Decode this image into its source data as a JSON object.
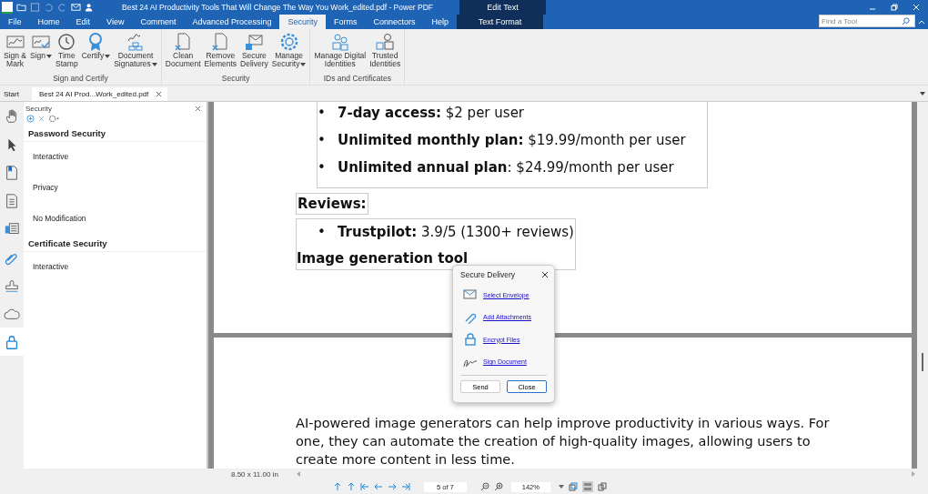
{
  "title_bar": {
    "title": "Best 24 AI Productivity Tools That Will Change The Way You Work_edited.pdf - Power PDF",
    "context_tab": "Edit Text"
  },
  "menu_tabs": [
    {
      "label": "File",
      "selected": false
    },
    {
      "label": "Home",
      "selected": false
    },
    {
      "label": "Edit",
      "selected": false
    },
    {
      "label": "View",
      "selected": false
    },
    {
      "label": "Comment",
      "selected": false
    },
    {
      "label": "Advanced Processing",
      "selected": false
    },
    {
      "label": "Security",
      "selected": true
    },
    {
      "label": "Forms",
      "selected": false
    },
    {
      "label": "Connectors",
      "selected": false
    },
    {
      "label": "Help",
      "selected": false
    }
  ],
  "context_menu_tab": "Text Format",
  "find_tool": {
    "placeholder": "Find a Tool"
  },
  "ribbon_groups": [
    {
      "label": "Sign and Certify",
      "buttons": [
        {
          "label": "Sign &\nMark",
          "dropdown": false
        },
        {
          "label": "Sign",
          "dropdown": true
        },
        {
          "label": "Time\nStamp",
          "dropdown": false
        },
        {
          "label": "Certify",
          "dropdown": true
        },
        {
          "label": "Document\nSignatures",
          "dropdown": true
        }
      ]
    },
    {
      "label": "Security",
      "buttons": [
        {
          "label": "Clean\nDocument",
          "dropdown": false
        },
        {
          "label": "Remove\nElements",
          "dropdown": false
        },
        {
          "label": "Secure\nDelivery",
          "dropdown": false
        },
        {
          "label": "Manage\nSecurity",
          "dropdown": true
        }
      ]
    },
    {
      "label": "IDs and Certificates",
      "buttons": [
        {
          "label": "Manage Digital\nIdentities",
          "dropdown": false
        },
        {
          "label": "Trusted\nIdentities",
          "dropdown": false
        }
      ]
    }
  ],
  "doc_tabs": [
    {
      "label": "Start",
      "selected": false,
      "closable": false
    },
    {
      "label": "Best 24 AI Prod...Work_edited.pdf",
      "selected": true,
      "closable": true
    }
  ],
  "side_tools": [
    {
      "selected": false
    },
    {
      "selected": false
    },
    {
      "selected": false
    },
    {
      "selected": false
    },
    {
      "selected": false
    },
    {
      "selected": false
    },
    {
      "selected": false
    },
    {
      "selected": false
    },
    {
      "selected": true
    }
  ],
  "panel": {
    "title": "Security",
    "sections": [
      {
        "heading": "Password Security",
        "items": [
          "Interactive",
          "Privacy",
          "No Modification"
        ]
      },
      {
        "heading": "Certificate Security",
        "items": [
          "Interactive"
        ]
      }
    ]
  },
  "page_one": {
    "plans": [
      {
        "bullet": "•",
        "text": "**7-day access:** $2 per user"
      },
      {
        "bullet": "•",
        "text": "**Unlimited monthly plan:** $19.99/month per user"
      },
      {
        "bullet": "•",
        "text": "**Unlimited annual plan**: $24.99/month per user"
      }
    ],
    "reviews_heading": "Reviews:",
    "reviews": [
      {
        "bullet": "•",
        "text": "**Trustpilot:** 3.9/5 (1300+ reviews)"
      }
    ],
    "section_heading": "Image generation tool"
  },
  "page_two": {
    "paragraph": "AI-powered image generators can help improve productivity in various ways. For one, they can automate the creation of high-quality images, allowing users to create more content in less time."
  },
  "dialog": {
    "title": "Secure Delivery",
    "links": [
      "Select Envelope",
      "Add Attachments",
      "Encrypt Files",
      "Sign Document"
    ],
    "buttons": [
      {
        "label": "Send",
        "default": false
      },
      {
        "label": "Close",
        "default": true
      }
    ]
  },
  "status_bar": {
    "page_size": "8.50 x 11.00 in",
    "page_field": "5 of 7",
    "zoom": "142%"
  }
}
